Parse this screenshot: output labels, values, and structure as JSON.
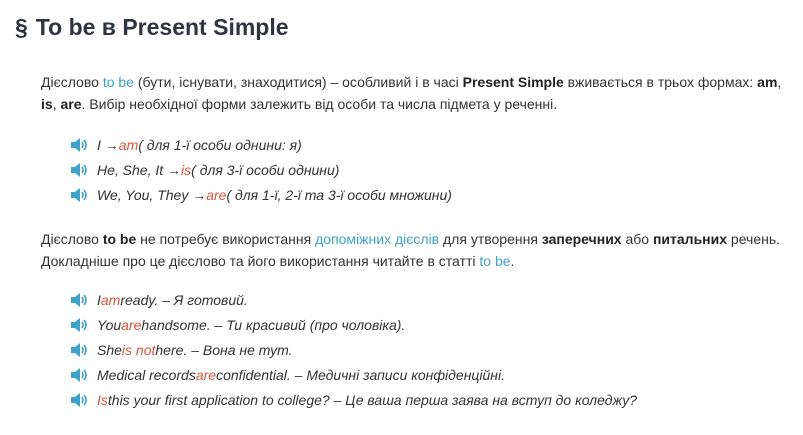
{
  "title": {
    "symbol": "§",
    "text": "To be в Present Simple"
  },
  "intro": {
    "t1": "Дієслово ",
    "link_to_be": "to be",
    "t2": " (бути, існувати, знаходитися) – особливий і в часі ",
    "present_simple": "Present Simple",
    "t3": " вживається в трьох формах: ",
    "am": "am",
    "c1": ", ",
    "is": "is",
    "c2": ", ",
    "are": "are",
    "t4": ". Вибір необхідної форми залежить від особи та числа підмета у реченні."
  },
  "forms": [
    {
      "pre": "I → ",
      "verb": "am",
      "post": " ( для 1-ї особи однини: я)"
    },
    {
      "pre": "He, She, It → ",
      "verb": "is",
      "post": " ( для 3-ї особи однини)"
    },
    {
      "pre": "We, You, They → ",
      "verb": "are",
      "post": "( для 1-ї, 2-ї та 3-ї особи множини)"
    }
  ],
  "second": {
    "t1": "Дієслово ",
    "to_be": "to be",
    "t2": " не потребує використання ",
    "link_aux": "допоміжних дієслів",
    "t3": " для утворення ",
    "neg": "заперечних",
    "t4": " або ",
    "q": "питальних",
    "t5": " речень. Докладніше про це дієслово та його використання читайте в статті ",
    "link_to_be": "to be",
    "t6": "."
  },
  "examples": [
    {
      "pre": "I ",
      "verb": "am",
      "post": " ready. – Я готовий."
    },
    {
      "pre": "You ",
      "verb": "are",
      "post": " handsome. – Ти красивий (про чоловіка)."
    },
    {
      "pre": "She ",
      "verb": "is not",
      "post": " here. –  Вона не тут."
    },
    {
      "pre": "Medical records ",
      "verb": "are",
      "post": " confidential. – Медичні записи конфіденційні."
    },
    {
      "pre": "",
      "verb": "Is",
      "post": " this your first application to college? – Це ваша перша заява на вступ до коледжу?"
    }
  ],
  "icons": {
    "audio": "speaker-icon"
  },
  "colors": {
    "link": "#3ea1c7",
    "highlight": "#d9543a",
    "icon": "#3ea1c7"
  }
}
